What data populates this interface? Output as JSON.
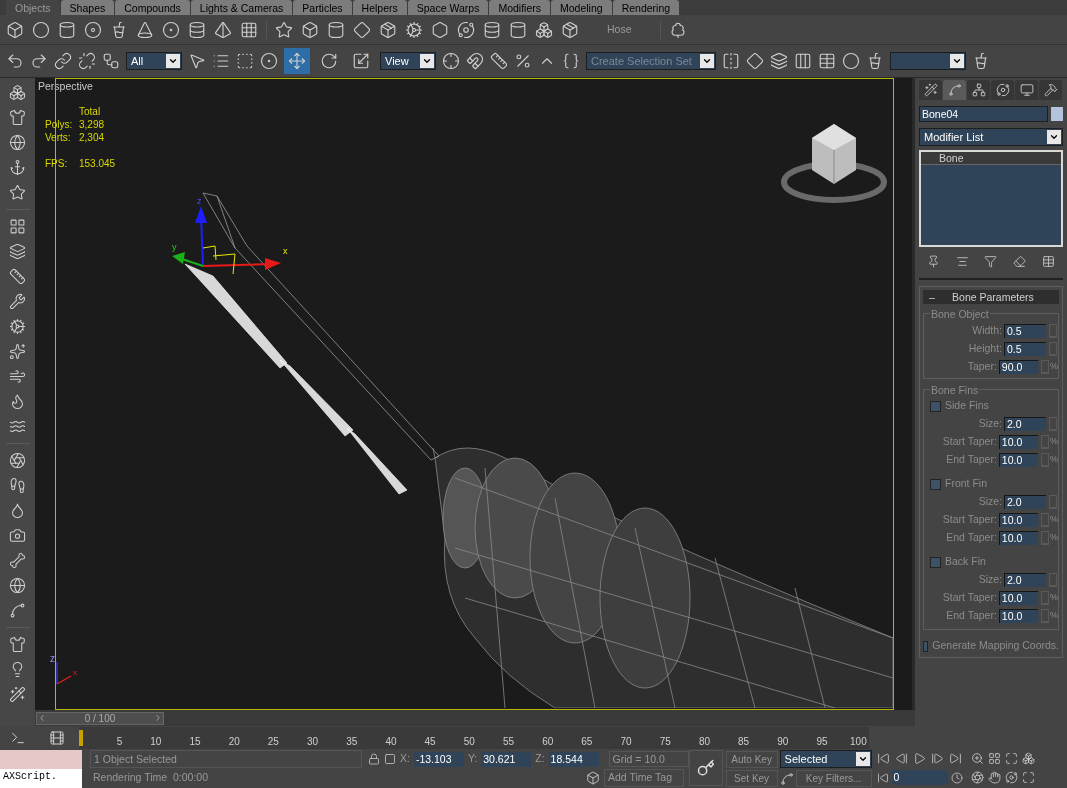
{
  "command_tabs": [
    {
      "label": "Objects",
      "selected": true
    },
    {
      "label": "Shapes",
      "selected": false
    },
    {
      "label": "Compounds",
      "selected": false
    },
    {
      "label": "Lights & Cameras",
      "selected": false
    },
    {
      "label": "Particles",
      "selected": false
    },
    {
      "label": "Helpers",
      "selected": false
    },
    {
      "label": "Space Warps",
      "selected": false
    },
    {
      "label": "Modifiers",
      "selected": false
    },
    {
      "label": "Modeling",
      "selected": false
    },
    {
      "label": "Rendering",
      "selected": false
    }
  ],
  "create_toolbar": {
    "label": "Hose"
  },
  "main_toolbar": {
    "selection_filter": "All",
    "coordinate_system": "View",
    "selection_set_placeholder": "Create Selection Set",
    "transform_tools": [
      {
        "kind": "move",
        "selected": true
      },
      {
        "kind": "rotate",
        "selected": false
      },
      {
        "kind": "scale",
        "selected": false
      }
    ]
  },
  "viewport": {
    "label": "Perspective",
    "stats_header": "Total",
    "counts": [
      {
        "label": "Polys:",
        "value": "3,298"
      },
      {
        "label": "Verts:",
        "value": "2,304"
      }
    ],
    "fps": {
      "label": "FPS:",
      "value": "153.045"
    },
    "gizmo_labels": {
      "x": "x",
      "y": "y",
      "z": "z"
    },
    "tripod_labels": {
      "x": "x",
      "z": "z"
    }
  },
  "command_panel": {
    "tabs": [
      {
        "kind": "create",
        "selected": false
      },
      {
        "kind": "modify",
        "selected": true
      },
      {
        "kind": "hierarchy",
        "selected": false
      },
      {
        "kind": "motion",
        "selected": false
      },
      {
        "kind": "display",
        "selected": false
      },
      {
        "kind": "utilities",
        "selected": false
      }
    ],
    "object_name": "Bone04",
    "modifier_list": "Modifier List",
    "stack": [
      {
        "label": "Bone"
      }
    ],
    "rollout": {
      "toggle": "–",
      "title": "Bone Parameters",
      "bone_object": {
        "title": "Bone Object",
        "fields": [
          {
            "label": "Width:",
            "value": "0.5"
          },
          {
            "label": "Height:",
            "value": "0.5"
          },
          {
            "label": "Taper:",
            "value": "90.0",
            "unit": "%"
          }
        ]
      },
      "bone_fins": {
        "title": "Bone Fins",
        "fins": [
          {
            "label": "Side Fins",
            "checked": false,
            "fields": [
              {
                "label": "Size:",
                "value": "2.0"
              },
              {
                "label": "Start Taper:",
                "value": "10.0",
                "unit": "%"
              },
              {
                "label": "End Taper:",
                "value": "10.0",
                "unit": "%"
              }
            ]
          },
          {
            "label": "Front Fin",
            "checked": false,
            "fields": [
              {
                "label": "Size:",
                "value": "2.0"
              },
              {
                "label": "Start Taper:",
                "value": "10.0",
                "unit": "%"
              },
              {
                "label": "End Taper:",
                "value": "10.0",
                "unit": "%"
              }
            ]
          },
          {
            "label": "Back Fin",
            "checked": false,
            "fields": [
              {
                "label": "Size:",
                "value": "2.0"
              },
              {
                "label": "Start Taper:",
                "value": "10.0",
                "unit": "%"
              },
              {
                "label": "End Taper:",
                "value": "10.0",
                "unit": "%"
              }
            ]
          }
        ]
      },
      "mapping": {
        "label": "Generate Mapping Coords.",
        "checked": false
      }
    }
  },
  "timeline": {
    "position": "0 / 100",
    "ticks": [
      "5",
      "10",
      "15",
      "20",
      "25",
      "30",
      "35",
      "40",
      "45",
      "50",
      "55",
      "60",
      "65",
      "70",
      "75",
      "80",
      "85",
      "90",
      "95",
      "100"
    ]
  },
  "status": {
    "listener_input": "AXScript.",
    "prompt": "1 Object Selected",
    "render_time": "Rendering Time  0:00:00",
    "coords": [
      {
        "label": "X:",
        "value": "-13.103"
      },
      {
        "label": "Y:",
        "value": "30.621"
      },
      {
        "label": "Z:",
        "value": "18.544"
      }
    ],
    "grid": "Grid = 10.0",
    "add_time_tag": "Add Time Tag",
    "auto_key": "Auto Key",
    "key_mode": "Selected",
    "set_key": "Set Key",
    "key_filters": "Key Filters...",
    "frame": "0"
  }
}
